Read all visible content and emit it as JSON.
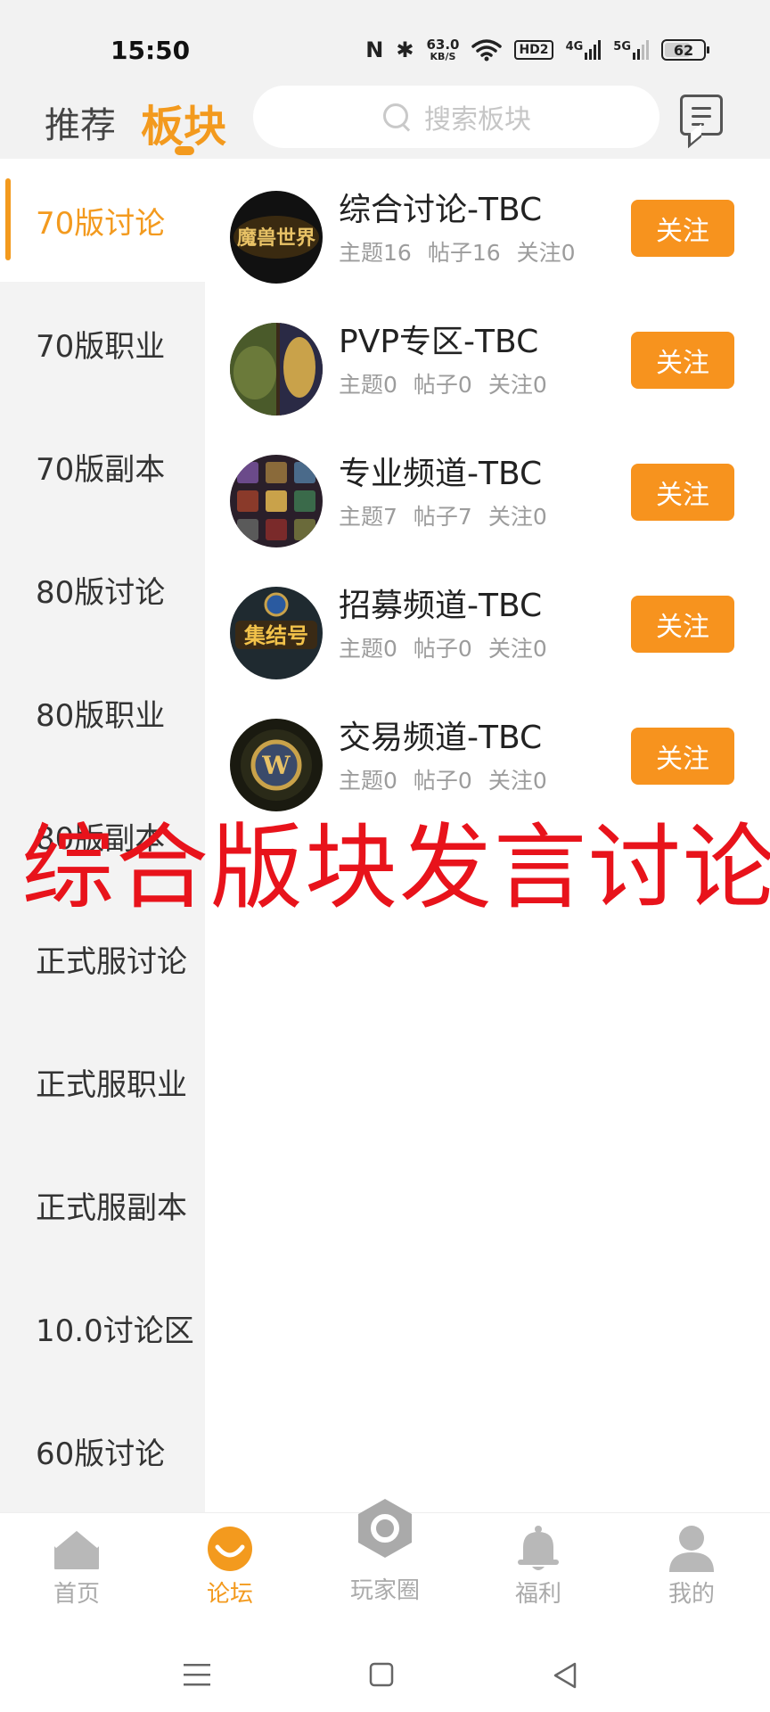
{
  "status_bar": {
    "time": "15:50",
    "network_speed": "63.0",
    "network_speed_unit": "KB/S",
    "hd_label": "HD2",
    "signal1_label": "4G",
    "signal2_label": "5G",
    "battery": "62",
    "battery_level_percent": 62
  },
  "header": {
    "tab_recommend": "推荐",
    "tab_sections": "板块",
    "search_placeholder": "搜索板块",
    "message_icon": "message-icon"
  },
  "sidebar": {
    "items": [
      {
        "label": "70版讨论",
        "active": true
      },
      {
        "label": "70版职业"
      },
      {
        "label": "70版副本"
      },
      {
        "label": "80版讨论"
      },
      {
        "label": "80版职业"
      },
      {
        "label": "80版副本"
      },
      {
        "label": "正式服讨论"
      },
      {
        "label": "正式服职业"
      },
      {
        "label": "正式服副本"
      },
      {
        "label": "10.0讨论区"
      },
      {
        "label": "60版讨论"
      }
    ]
  },
  "boards": [
    {
      "title": "综合讨论-TBC",
      "topics": "主题16",
      "posts": "帖子16",
      "follows": "关注0",
      "follow_label": "关注",
      "avatar_text": "魔兽世界"
    },
    {
      "title": "PVP专区-TBC",
      "topics": "主题0",
      "posts": "帖子0",
      "follows": "关注0",
      "follow_label": "关注",
      "avatar_text": ""
    },
    {
      "title": "专业频道-TBC",
      "topics": "主题7",
      "posts": "帖子7",
      "follows": "关注0",
      "follow_label": "关注",
      "avatar_text": ""
    },
    {
      "title": "招募频道-TBC",
      "topics": "主题0",
      "posts": "帖子0",
      "follows": "关注0",
      "follow_label": "关注",
      "avatar_text": "集结号"
    },
    {
      "title": "交易频道-TBC",
      "topics": "主题0",
      "posts": "帖子0",
      "follows": "关注0",
      "follow_label": "关注",
      "avatar_text": "W"
    }
  ],
  "watermark": "综合版块发言讨论",
  "bottom_nav": {
    "items": [
      {
        "label": "首页",
        "icon": "home-icon"
      },
      {
        "label": "论坛",
        "icon": "forum-icon",
        "active": true
      },
      {
        "label": "玩家圈",
        "icon": "player-circle-icon"
      },
      {
        "label": "福利",
        "icon": "bell-icon"
      },
      {
        "label": "我的",
        "icon": "profile-icon"
      }
    ]
  },
  "colors": {
    "accent": "#f39a1e",
    "follow_button": "#f7931e",
    "watermark": "#e8131b",
    "sidebar_bg": "#f3f3f3"
  }
}
